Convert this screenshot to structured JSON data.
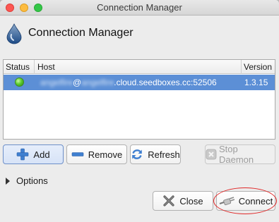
{
  "window": {
    "title": "Connection Manager"
  },
  "header": {
    "title": "Connection Manager"
  },
  "table": {
    "columns": [
      "Status",
      "Host",
      "Version"
    ],
    "rows": [
      {
        "status": "online",
        "host_user": "angelfire",
        "host_at": "@",
        "host_sub": "angelfire",
        "host_domain": ".cloud.seedboxes.cc:52506",
        "version": "1.3.15"
      }
    ]
  },
  "buttons": {
    "add": "Add",
    "remove": "Remove",
    "refresh": "Refresh",
    "stop_daemon": "Stop Daemon",
    "close": "Close",
    "connect": "Connect"
  },
  "options": {
    "label": "Options"
  },
  "colors": {
    "selection": "#5c8fd6",
    "status_online": "#5ccc2e",
    "annotation": "#e02727"
  },
  "icons": {
    "header": "deluge-droplet-icon",
    "add": "plus-icon",
    "remove": "minus-icon",
    "refresh": "refresh-icon",
    "stop": "stop-icon",
    "close": "close-x-icon",
    "connect": "plug-icon"
  }
}
